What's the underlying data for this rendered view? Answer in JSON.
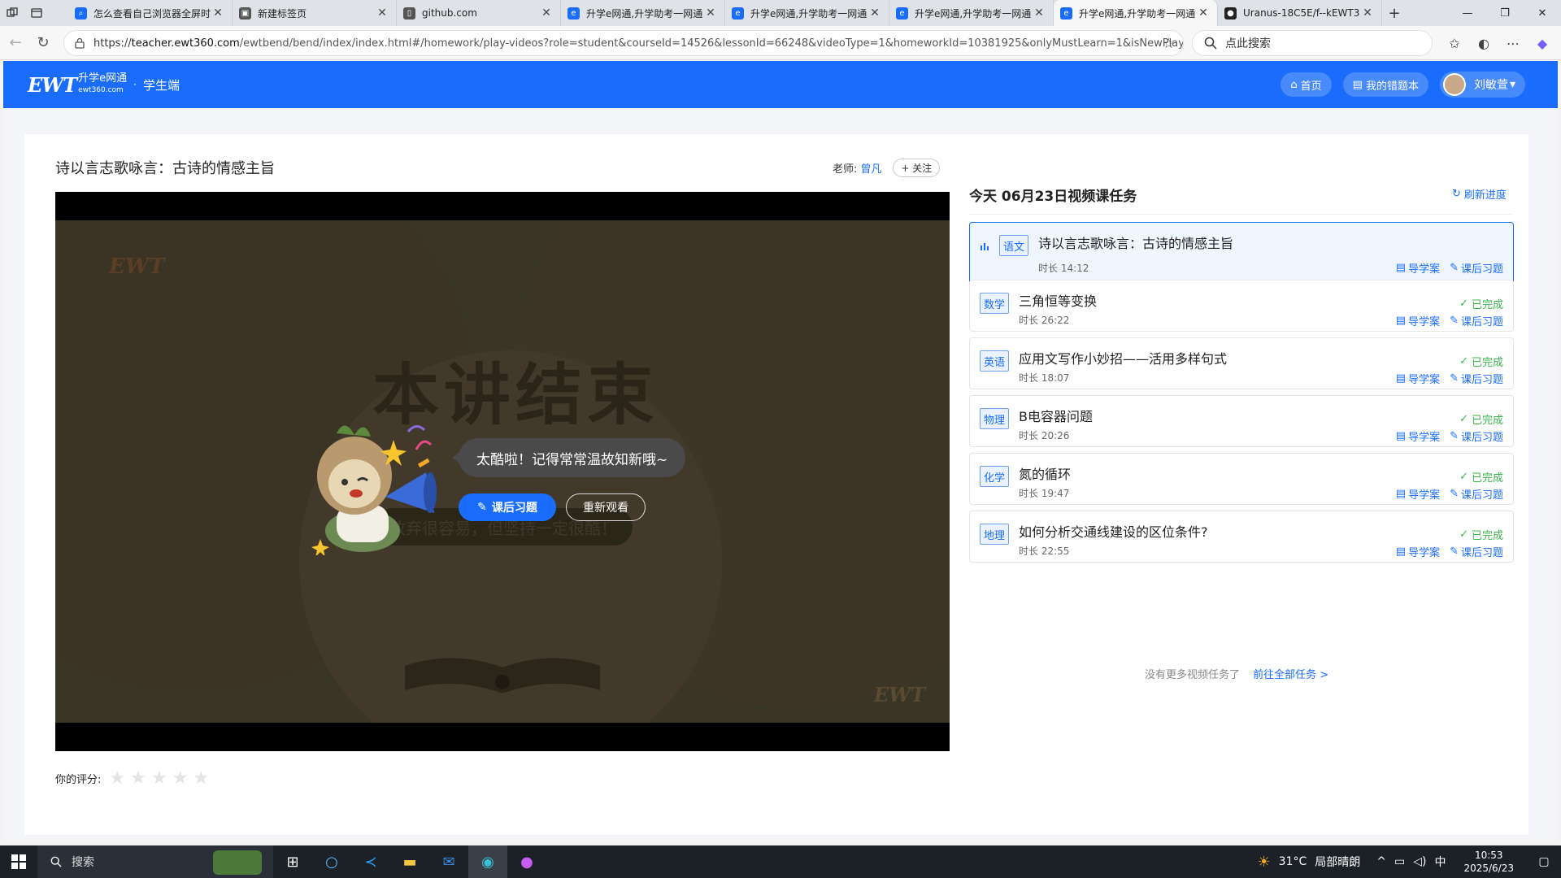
{
  "browser": {
    "tabs": [
      {
        "title": "怎么查看自己浏览器全屏时",
        "icon": "search-icon"
      },
      {
        "title": "新建标签页",
        "icon": "newtab-icon"
      },
      {
        "title": "github.com",
        "icon": "page-icon"
      },
      {
        "title": "升学e网通,升学助考一网通",
        "icon": "ewt-icon"
      },
      {
        "title": "升学e网通,升学助考一网通",
        "icon": "ewt-icon"
      },
      {
        "title": "升学e网通,升学助考一网通",
        "icon": "ewt-icon"
      },
      {
        "title": "升学e网通,升学助考一网通",
        "icon": "ewt-icon",
        "active": true
      },
      {
        "title": "Uranus-18C5E/f--kEWT360",
        "icon": "github-icon"
      }
    ],
    "url_prefix": "https://",
    "url_host": "teacher.ewt360.com",
    "url_path": "/ewtbend/bend/index/index.html#/homework/play-videos?role=student&courseId=14526&lessonId=66248&videoType=1&homeworkId=10381925&onlyMustLearn=1&isNewPlayer...",
    "search_placeholder": "点此搜索"
  },
  "header": {
    "logo_text": "EWT",
    "brand_name": "升学e网通",
    "brand_domain": "ewt360.com",
    "separator": "·",
    "portal": "学生端",
    "home_label": "首页",
    "wrongbook_label": "我的错题本",
    "user_name": "刘敏萱",
    "user_caret": "▾"
  },
  "lesson": {
    "title": "诗以言志歌咏言：古诗的情感主旨",
    "teacher_label": "老师:",
    "teacher_name": "曾凡",
    "follow_label": "+ 关注"
  },
  "video": {
    "watermark": "EWT",
    "watermark_small": "ewt360.com",
    "end_text": "本讲结束",
    "motto": "放弃很容易，但坚持一定很酷！",
    "speech": "太酷啦！记得常常温故知新哦~",
    "homework_button": "课后习题",
    "rewatch_button": "重新观看"
  },
  "rating": {
    "label": "你的评分:",
    "value": 0,
    "max": 5
  },
  "tasks_panel": {
    "title": "今天 06月23日视频课任务",
    "refresh_label": "刷新进度",
    "guide_label": "导学案",
    "homework_label": "课后习题",
    "done_label": "已完成",
    "duration_prefix": "时长 ",
    "tasks": [
      {
        "subject": "语文",
        "title": "诗以言志歌咏言：古诗的情感主旨",
        "duration": "14:12",
        "status": "playing"
      },
      {
        "subject": "数学",
        "title": "三角恒等变换",
        "duration": "26:22",
        "status": "done"
      },
      {
        "subject": "英语",
        "title": "应用文写作小妙招——活用多样句式",
        "duration": "18:07",
        "status": "done"
      },
      {
        "subject": "物理",
        "title": "B电容器问题",
        "duration": "20:26",
        "status": "done"
      },
      {
        "subject": "化学",
        "title": "氮的循环",
        "duration": "19:47",
        "status": "done"
      },
      {
        "subject": "地理",
        "title": "如何分析交通线建设的区位条件?",
        "duration": "22:55",
        "status": "done"
      }
    ],
    "no_more": "没有更多视频任务了",
    "go_all": "前往全部任务 >"
  },
  "taskbar": {
    "search_label": "搜索",
    "weather": "31°C",
    "weather_desc": "局部晴朗",
    "ime": "中",
    "time": "10:53",
    "date": "2025/6/23"
  },
  "colors": {
    "brand_blue": "#1a6dfc",
    "done_green": "#3bb54a"
  }
}
